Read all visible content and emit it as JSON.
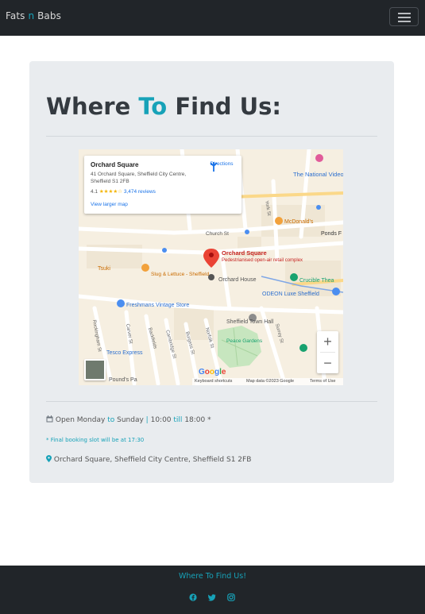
{
  "navbar": {
    "brand_part1": "Fats ",
    "brand_accent": "n",
    "brand_part2": " Babs",
    "toggler_icon": "hamburger-menu-icon"
  },
  "page": {
    "title_part1": "Where ",
    "title_accent": "To",
    "title_part2": " Find Us:"
  },
  "map": {
    "place_name": "Orchard Square",
    "place_address": "41 Orchard Square, Sheffield City Centre, Sheffield S1 2FB",
    "rating": "4.1",
    "stars": "★★★★☆",
    "reviews": "3,474 reviews",
    "directions_label": "Directions",
    "larger_map_link": "View larger map",
    "pin_label": "Orchard Square",
    "pin_sublabel": "Pedestrianised open-air retail complex",
    "labels": [
      "The National Videogame Museum",
      "McDonald's",
      "Ponds F",
      "Church St",
      "Tsuki",
      "Slug & Lettuce - Sheffield",
      "Orchard House",
      "Crucible Thea",
      "Freshmans Vintage Store",
      "ODEON Luxe Sheffield",
      "Sheffield Town Hall",
      "Peace Gardens",
      "Tesco Express",
      "Pound's Pa",
      "York St",
      "Rockingham St",
      "Carver St",
      "Backfields",
      "Cambridge St",
      "Burgess St",
      "Norfolk St",
      "Surrey St"
    ],
    "zoom_in": "+",
    "zoom_out": "−",
    "google_logo": "Google",
    "keyboard_shortcuts": "Keyboard shortcuts",
    "map_data": "Map data ©2023 Google",
    "terms": "Terms of Use"
  },
  "hours": {
    "icon": "calendar-icon",
    "open_day": "Open Monday",
    "to_word": "to",
    "close_day": "Sunday",
    "separator": "|",
    "open_time": "10:00",
    "till_word": "till",
    "close_time": "18:00 *"
  },
  "note": "* Final booking slot will be at 17:30",
  "address": {
    "icon": "map-marker-icon",
    "text": "Orchard Square, Sheffield City Centre, Sheffield S1 2FB"
  },
  "footer": {
    "title": "Where To Find Us!",
    "social_icons": [
      "facebook-icon",
      "twitter-icon",
      "instagram-icon"
    ]
  },
  "colors": {
    "accent": "#17a2b8",
    "navbar_bg": "#212529",
    "card_bg": "#e9ecef",
    "pin_red": "#ea4335"
  }
}
